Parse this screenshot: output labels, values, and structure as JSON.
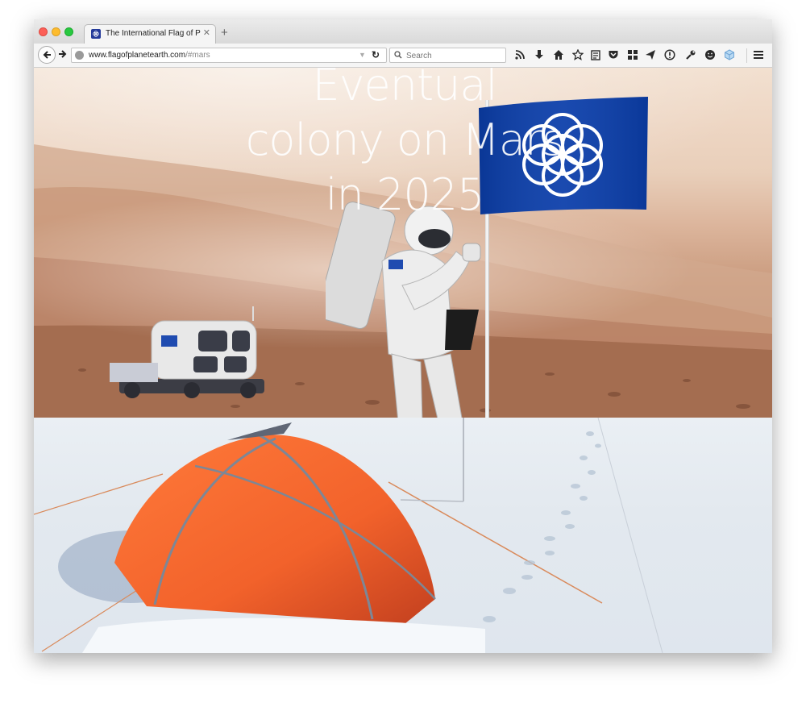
{
  "browser": {
    "tab": {
      "title": "The International Flag of Planet Earth"
    },
    "url": {
      "host": "www.flagofplanetearth.com",
      "path": "/#mars"
    },
    "search": {
      "placeholder": "Search"
    },
    "toolbar_icons": [
      "rss-icon",
      "download-icon",
      "home-icon",
      "bookmark-star-icon",
      "reading-list-icon",
      "pocket-icon",
      "grid-icon",
      "send-icon",
      "info-icon",
      "wrench-icon",
      "emoji-icon",
      "cube-icon",
      "menu-icon"
    ]
  },
  "hero": {
    "line1": "Eventual",
    "line2": "colony on Mars",
    "line3": "in 2025"
  },
  "colors": {
    "flag_blue": "#0b3eaa",
    "tent_orange": "#f2622b"
  }
}
